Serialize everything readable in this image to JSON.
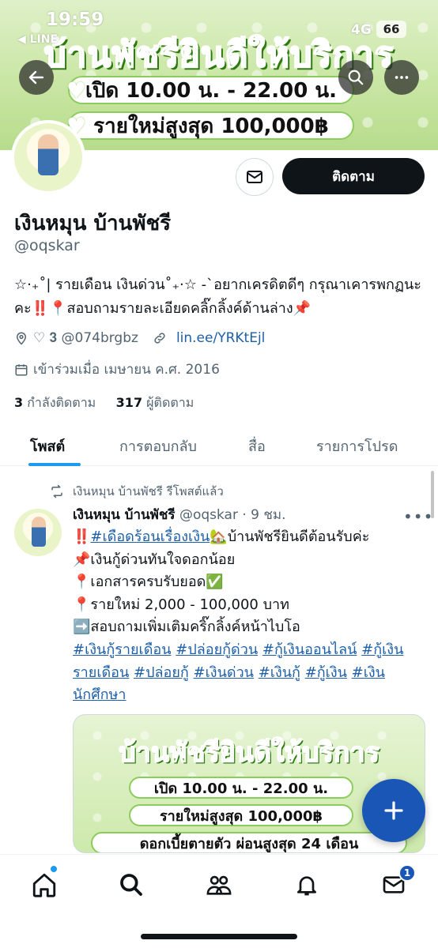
{
  "status_bar": {
    "time": "19:59",
    "back_app": "◀ LINE",
    "network": "4G",
    "battery": "66"
  },
  "banner": {
    "title": "บ้านพัชรียินดีให้บริการ",
    "line1": "เปิด 10.00 น. - 22.00 น.",
    "line2": "รายใหม่สูงสุด 100,000฿"
  },
  "header_buttons": {
    "back_icon": "arrow-left-icon",
    "search_icon": "search-icon",
    "more_icon": "more-horizontal-icon"
  },
  "profile": {
    "display_name": "เงินหมุน บ้านพัชรี",
    "handle": "@oqskar",
    "follow_label": "ติดตาม",
    "bio": "☆·₊˚| รายเดือน เงินด่วน˚₊·☆ -`อยากเครดิตดีๆ กรุณาเคารพกฏนะคะ‼️📍สอบถามรายละเอียดคลิ๊กลิ้งค์ด้านล่าง📌",
    "location": "♡ 𝟑 @074brgbz",
    "website": "lin.ee/YRKtEjl",
    "joined": "เข้าร่วมเมื่อ เมษายน ค.ศ. 2016",
    "following_count": "3",
    "following_label": "กำลังติดตาม",
    "followers_count": "317",
    "followers_label": "ผู้ติดตาม"
  },
  "tabs": [
    {
      "label": "โพสต์",
      "active": true
    },
    {
      "label": "การตอบกลับ",
      "active": false
    },
    {
      "label": "สื่อ",
      "active": false
    },
    {
      "label": "รายการโปรด",
      "active": false
    }
  ],
  "post": {
    "repost_label": "เงินหมุน บ้านพัชรี รีโพสต์แล้ว",
    "author": "เงินหมุน บ้านพัชรี",
    "handle_time": "@oqskar · 9 ชม.",
    "lines": [
      {
        "prefix": "‼️",
        "tag": "#เดือดร้อนเรื่องเงิน",
        "rest": "🏡บ้านพัชรียินดีต้อนรับค่ะ"
      },
      {
        "prefix": "📌",
        "tag": "",
        "rest": "เงินกู้ด่วนทันใจดอกน้อย"
      },
      {
        "prefix": "📍",
        "tag": "",
        "rest": "เอกสารครบรับยอด✅"
      },
      {
        "prefix": "📍",
        "tag": "",
        "rest": "รายใหม่ 2,000 - 100,000 บาท"
      },
      {
        "prefix": "➡️",
        "tag": "",
        "rest": "สอบถามเพิ่มเติมคริ๊กลิ้งค์หน้าไบโอ"
      }
    ],
    "hashtags": [
      "#เงินกู้รายเดือน",
      "#ปล่อยกู้ด่วน",
      "#กู้เงินออนไลน์",
      "#กู้เงินรายเดือน",
      "#ปล่อยกู้",
      "#เงินด่วน",
      "#เงินกู้",
      "#กู้เงิน",
      "#เงินนักศึกษา"
    ],
    "image": {
      "title": "บ้านพัชรียินดีให้บริการ",
      "line1": "เปิด 10.00 น. - 22.00 น.",
      "line2": "รายใหม่สูงสุด 100,000฿",
      "line3": "ดอกเบี้ยตายตัว ผ่อนสูงสุด 24 เดือน"
    }
  },
  "bottom_nav": {
    "items": [
      "home-icon",
      "search-icon",
      "communities-icon",
      "notifications-icon",
      "messages-icon"
    ],
    "messages_badge": "1"
  },
  "colors": {
    "accent": "#1d9bf0",
    "fab": "#1a56b5",
    "link": "#1d5fa8",
    "banner_green": "#3fae1c"
  }
}
